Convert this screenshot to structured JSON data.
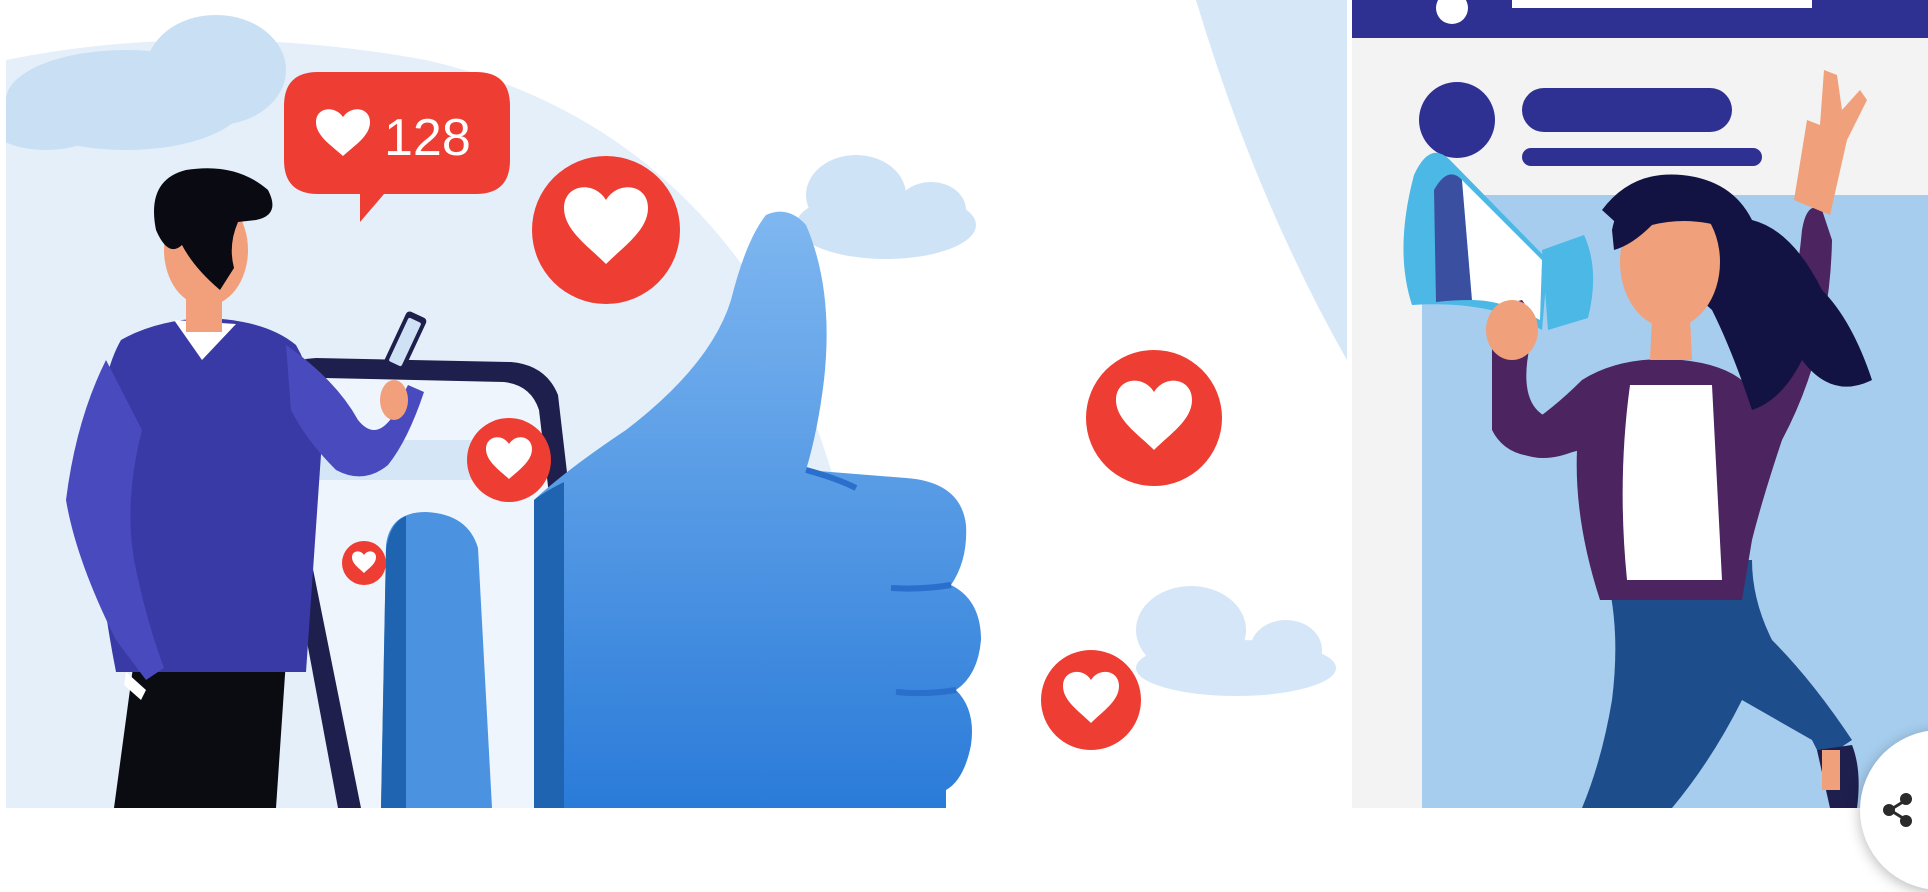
{
  "colors": {
    "accent_red": "#ee3d32",
    "thumb_blue": "#3f8ee3",
    "navy": "#2e3192",
    "purple": "#4b2460",
    "background": "#ffffff"
  },
  "left_card": {
    "like_badge": {
      "icon": "heart-icon",
      "count": "128"
    },
    "floating_heart_icons": [
      "heart-icon",
      "heart-icon",
      "heart-icon",
      "heart-icon",
      "heart-icon",
      "heart-icon"
    ],
    "illustration_subject": "thumbs-up-icon"
  },
  "right_card": {
    "illustration_subject": "megaphone-icon"
  },
  "share_button": {
    "icon": "share-icon"
  }
}
